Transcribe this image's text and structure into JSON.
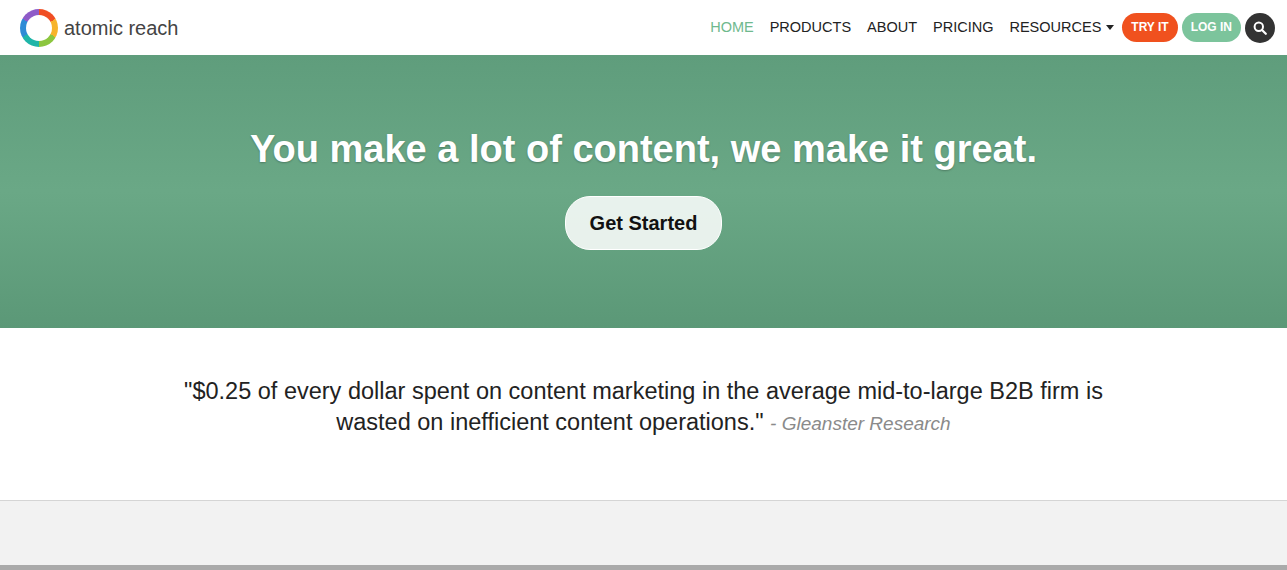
{
  "brand": {
    "name": "atomic reach"
  },
  "nav": {
    "items": [
      {
        "label": "HOME",
        "selected": true,
        "kind": "link"
      },
      {
        "label": "PRODUCTS",
        "selected": false,
        "kind": "link"
      },
      {
        "label": "ABOUT",
        "selected": false,
        "kind": "link"
      },
      {
        "label": "PRICING",
        "selected": false,
        "kind": "link"
      },
      {
        "label": "RESOURCES",
        "selected": false,
        "kind": "dropdown"
      }
    ]
  },
  "actions": [
    {
      "label": "TRY IT",
      "color": "#f0511e"
    },
    {
      "label": "LOG IN",
      "color": "#7cc49c"
    }
  ],
  "hero": {
    "headline": "You make a lot of content, we make it great.",
    "button": "Get Started"
  },
  "quote": {
    "text": "\"$0.25 of every dollar spent on content marketing in the average mid-to-large B2B firm is wasted on inefficient content operations.\"",
    "source": "- Gleanster Research"
  }
}
